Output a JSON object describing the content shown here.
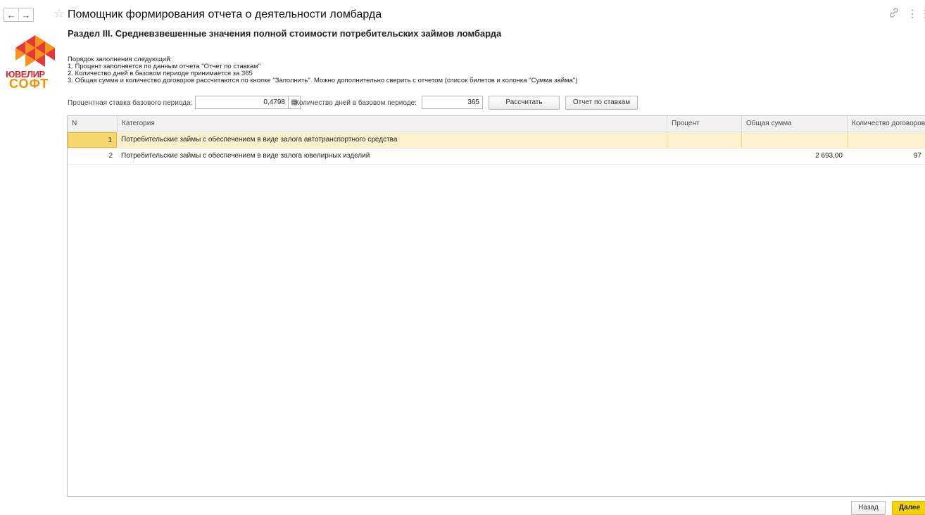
{
  "window": {
    "title": "Помощник формирования отчета о деятельности ломбарда",
    "back_glyph": "←",
    "forward_glyph": "→",
    "star_glyph": "☆",
    "link_glyph": "🔗",
    "more_glyph": "⋮"
  },
  "logo": {
    "line1": "ЮВЕЛИР",
    "line2": "СОФТ",
    "colors": {
      "red": "#e53935",
      "orange": "#f7941d",
      "text_red": "#d7262b",
      "text_orange": "#f39200"
    }
  },
  "section": {
    "title": "Раздел III. Средневзвешенные значения полной стоимости потребительских займов ломбарда"
  },
  "instructions": [
    "Порядок заполнения следующий:",
    "1. Процент заполняется по данным отчета \"Отчет по ставкам\"",
    "2. Количество дней в базовом периоде принимается за 365",
    "3. Общая сумма и количество договоров рассчитаются по кнопке \"Заполнить\". Можно дополнительно сверить с отчетом (список билетов и колонка \"Сумма займа\")"
  ],
  "controls": {
    "rate_label": "Процентная ставка базового периода:",
    "rate_value": "0,4798",
    "calc_icon_glyph": "▦",
    "days_label": "Количество дней в базовом периоде:",
    "days_value": "365",
    "calculate_button": "Рассчитать",
    "report_button": "Отчет по ставкам"
  },
  "table": {
    "columns": [
      "N",
      "Категория",
      "Процент",
      "Общая сумма",
      "Количество договоров"
    ],
    "rows": [
      {
        "n": "1",
        "category": "Потребительские займы с обеспечением в виде залога автотранспортного средства",
        "percent": "",
        "total": "",
        "count": ""
      },
      {
        "n": "2",
        "category": "Потребительские займы с обеспечением в виде залога ювелирных изделий",
        "percent": "",
        "total": "2 693,00",
        "count": "97"
      }
    ]
  },
  "footer": {
    "back_button": "Назад",
    "next_button": "Далее"
  }
}
